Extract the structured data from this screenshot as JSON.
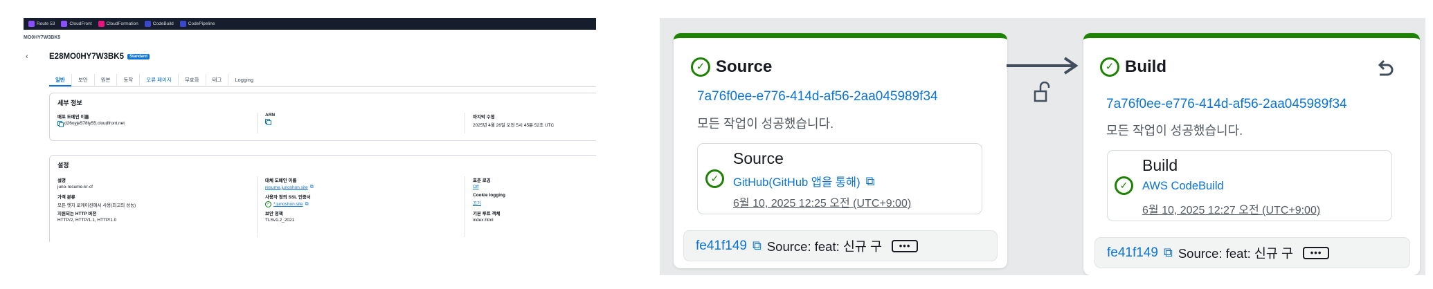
{
  "cloudfront": {
    "services": [
      {
        "name": "Route 53",
        "color": "#8c4fff"
      },
      {
        "name": "CloudFront",
        "color": "#8c4fff"
      },
      {
        "name": "CloudFormation",
        "color": "#e7157b"
      },
      {
        "name": "CodeBuild",
        "color": "#3b48cc"
      },
      {
        "name": "CodePipeline",
        "color": "#3b48cc"
      }
    ],
    "breadcrumb": "MO0HY7W3BK5",
    "distribution_id": "E28MO0HY7W3BK5",
    "badge": "Standard",
    "tabs": [
      "일반",
      "보안",
      "원본",
      "동작",
      "오류 페이지",
      "무효화",
      "태그",
      "Logging"
    ],
    "details": {
      "title": "세부 정보",
      "domain_label": "배포 도메인 이름",
      "domain_value": "d26oyje578ty55.cloudfront.net",
      "arn_label": "ARN",
      "modified_label": "마지막 수정",
      "modified_value": "2025년 4월 26일 오전 5시 45분 52초 UTC"
    },
    "settings": {
      "title": "설정",
      "desc_label": "설명",
      "desc_value": "juno-resume-kr-cf",
      "price_label": "가격 분류",
      "price_value": "모든 엣지 로케이션에서 사용(최고의 성능)",
      "http_label": "지원되는 HTTP 버전",
      "http_value": "HTTP/2, HTTP/1.1, HTTP/1.0",
      "alt_label": "대체 도메인 이름",
      "alt_value": "resume.junoshon.site",
      "ssl_label": "사용자 정의 SSL 인증서",
      "ssl_value": "*.junoshon.site",
      "policy_label": "보안 정책",
      "policy_value": "TLSv1.2_2021",
      "log_label": "표준 로깅",
      "log_value": "Off",
      "cookie_label": "Cookie logging",
      "cookie_value": "끄기",
      "root_label": "기본 루트 객체",
      "root_value": "index.html"
    }
  },
  "pipeline": {
    "colors": {
      "success": "#1d8102",
      "link": "#0972d3"
    },
    "stages": [
      {
        "title": "Source",
        "execution_id": "7a76f0ee-e776-414d-af56-2aa045989f34",
        "status": "모든 작업이 성공했습니다.",
        "action": {
          "name": "Source",
          "provider": "GitHub(GitHub 앱을 통해)",
          "time": "6월 10, 2025 12:25 오전 (UTC+9:00)"
        },
        "commit": {
          "id": "fe41f149",
          "message": "Source: feat: 신규 구",
          "more": "•••"
        }
      },
      {
        "title": "Build",
        "execution_id": "7a76f0ee-e776-414d-af56-2aa045989f34",
        "status": "모든 작업이 성공했습니다.",
        "action": {
          "name": "Build",
          "provider": "AWS CodeBuild",
          "time": "6월 10, 2025 12:27 오전 (UTC+9:00)"
        },
        "commit": {
          "id": "fe41f149",
          "message": "Source: feat: 신규 구",
          "more": "•••"
        }
      }
    ]
  }
}
